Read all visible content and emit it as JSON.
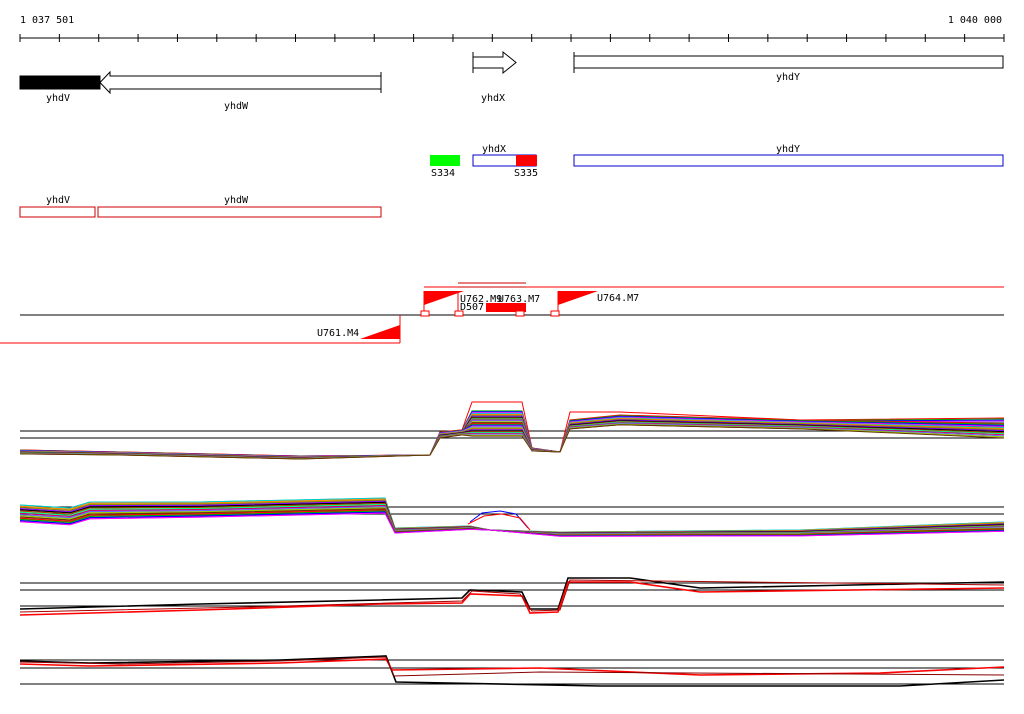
{
  "ruler": {
    "start_label": "1 037 501",
    "end_label": "1 040 000"
  },
  "annotation_genes": [
    {
      "label": "yhdV",
      "strand": "-",
      "style": "filled"
    },
    {
      "label": "yhdW",
      "strand": "-",
      "style": "open"
    },
    {
      "label": "yhdX",
      "strand": "+",
      "style": "open"
    },
    {
      "label": "yhdY",
      "strand": "+",
      "style": "open"
    }
  ],
  "plus_strand_features": [
    {
      "label": "S334",
      "color": "#00ff00"
    },
    {
      "label": "yhdX",
      "color": "#0000cc"
    },
    {
      "label": "S335",
      "color": "#ff0000"
    },
    {
      "label": "yhdY",
      "color": "#0000cc"
    }
  ],
  "minus_strand_features": [
    {
      "label": "yhdV",
      "color": "#cc0000"
    },
    {
      "label": "yhdW",
      "color": "#cc0000"
    }
  ],
  "transcription_units": [
    {
      "label": "U762.M9"
    },
    {
      "label": "U763.M7"
    },
    {
      "label": "U764.M7"
    },
    {
      "label": "D507"
    },
    {
      "label": "U761.M4"
    }
  ],
  "colors": {
    "black": "#000000",
    "red": "#ff0000",
    "blue": "#0000cc",
    "green": "#00ff00"
  }
}
